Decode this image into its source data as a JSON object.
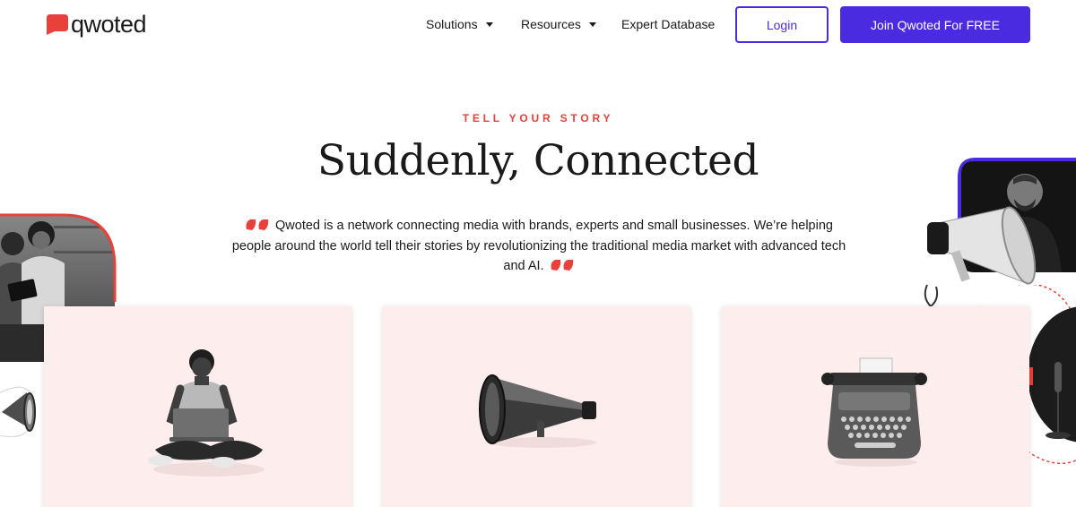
{
  "brand": {
    "name": "qwoted",
    "accent": "#e8403a",
    "primary": "#4b2be0"
  },
  "nav": {
    "items": [
      {
        "label": "Solutions",
        "has_dropdown": true
      },
      {
        "label": "Resources",
        "has_dropdown": true
      },
      {
        "label": "Expert Database",
        "has_dropdown": false
      }
    ],
    "login_label": "Login",
    "join_label": "Join Qwoted For FREE"
  },
  "hero": {
    "eyebrow": "TELL YOUR STORY",
    "title": "Suddenly, Connected",
    "intro": "Qwoted is a network connecting media with brands, experts and small businesses. We’re helping people around the world tell their stories by revolutionizing the traditional media market with advanced tech and AI."
  },
  "cards": [
    {
      "icon": "person-with-laptop-icon"
    },
    {
      "icon": "megaphone-icon"
    },
    {
      "icon": "typewriter-icon"
    }
  ],
  "decor": {
    "left_photo": "people-with-tablet-photo",
    "right_photo": "man-with-megaphone-photo"
  }
}
